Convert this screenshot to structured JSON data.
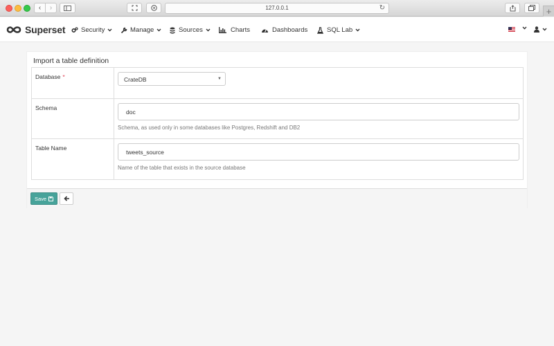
{
  "browser": {
    "url": "127.0.0.1",
    "back_icon": "chevron-left-icon",
    "forward_icon": "chevron-right-icon",
    "new_tab_label": "+"
  },
  "navbar": {
    "brand": "Superset",
    "items": [
      {
        "label": "Security",
        "icon": "gears-icon",
        "dropdown": true
      },
      {
        "label": "Manage",
        "icon": "wrench-icon",
        "dropdown": true
      },
      {
        "label": "Sources",
        "icon": "database-icon",
        "dropdown": true
      },
      {
        "label": "Charts",
        "icon": "bar-chart-icon",
        "dropdown": false
      },
      {
        "label": "Dashboards",
        "icon": "dashboard-icon",
        "dropdown": false
      },
      {
        "label": "SQL Lab",
        "icon": "flask-icon",
        "dropdown": true
      }
    ],
    "language_icon": "us-flag-icon",
    "user_icon": "user-icon"
  },
  "form": {
    "title": "Import a table definition",
    "database": {
      "label": "Database",
      "required_mark": "*",
      "selected": "CrateDB"
    },
    "schema": {
      "label": "Schema",
      "value": "doc",
      "help": "Schema, as used only in some databases like Postgres, Redshift and DB2"
    },
    "table_name": {
      "label": "Table Name",
      "value": "tweets_source",
      "help": "Name of the table that exists in the source database"
    },
    "save_label": "Save"
  },
  "colors": {
    "save_button": "#47a39a",
    "required": "#e04355",
    "page_bg": "#f5f5f5"
  }
}
